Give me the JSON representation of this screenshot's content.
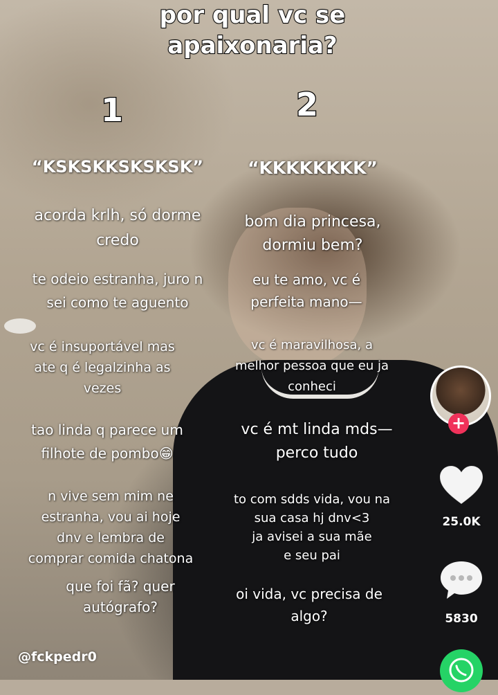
{
  "title": {
    "line1": "por qual vc se",
    "line2": "apaixonaria?"
  },
  "column1": {
    "number": "1",
    "quote": "“KSKSKKSKSKSK”",
    "messages": [
      [
        "acorda krlh, só dorme",
        "credo"
      ],
      [
        "te odeio estranha, juro n",
        "sei como te aguento"
      ],
      [
        "vc é insuportável mas",
        "ate q é legalzinha as",
        "vezes"
      ],
      [
        "tao linda q parece um",
        "filhote de pombo😁"
      ],
      [
        "n vive sem mim ne",
        "estranha, vou ai hoje",
        "dnv e lembra de",
        "comprar comida chatona"
      ],
      [
        "que foi fã? quer",
        "autógrafo?"
      ]
    ]
  },
  "column2": {
    "number": "2",
    "quote": "“KKKKKKKK”",
    "messages": [
      [
        "bom dia princesa,",
        "dormiu bem?"
      ],
      [
        "eu te amo, vc é",
        "perfeita mano—"
      ],
      [
        "vc é maravilhosa, a",
        "melhor pessoa que eu ja",
        "conheci"
      ],
      [
        "vc é mt linda mds—",
        "perco tudo"
      ],
      [
        "to com sdds vida, vou na",
        "sua casa hj dnv<3",
        "ja avisei a sua mãe",
        "e seu pai"
      ],
      [
        "oi vida, vc precisa de",
        "algo?"
      ]
    ]
  },
  "sidebar": {
    "avatar_icon": "profile-avatar",
    "follow_icon": "plus-icon",
    "follow_symbol": "+",
    "like_count": "25.0K",
    "comment_count": "5830",
    "share_icon": "whatsapp-icon"
  },
  "username": "@fckpedr0",
  "colors": {
    "follow": "#f0325a",
    "share": "#25d366",
    "text": "#ffffff"
  }
}
